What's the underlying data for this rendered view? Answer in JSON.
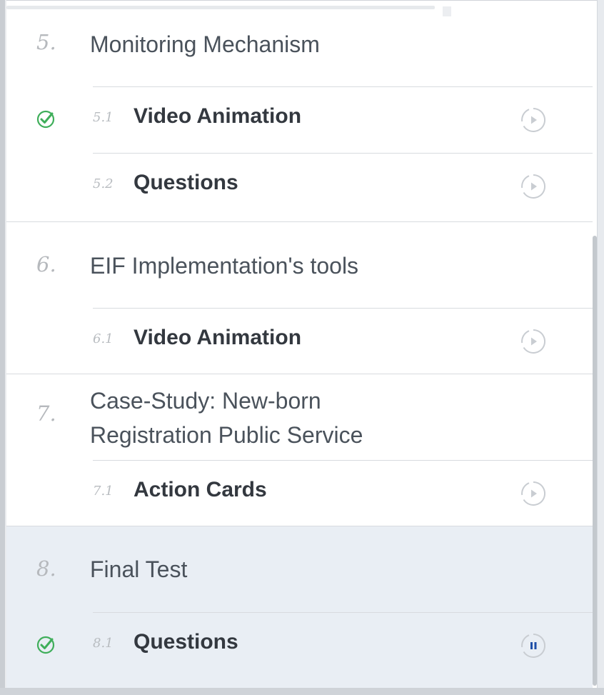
{
  "sections": [
    {
      "number": "5.",
      "title": "Monitoring Mechanism",
      "lessons": [
        {
          "number": "5.1",
          "title": "Video Animation",
          "completed": true,
          "state_icon": "play-circle-icon"
        },
        {
          "number": "5.2",
          "title": "Questions",
          "completed": false,
          "state_icon": "play-circle-icon"
        }
      ]
    },
    {
      "number": "6.",
      "title": "EIF Implementation's tools",
      "lessons": [
        {
          "number": "6.1",
          "title": "Video Animation",
          "completed": false,
          "state_icon": "play-circle-icon"
        }
      ]
    },
    {
      "number": "7.",
      "title_line1": "Case-Study: New-born",
      "title_line2": "Registration Public Service",
      "lessons": [
        {
          "number": "7.1",
          "title": "Action Cards",
          "completed": false,
          "state_icon": "play-circle-icon"
        }
      ]
    },
    {
      "number": "8.",
      "title": "Final Test",
      "active": true,
      "lessons": [
        {
          "number": "8.1",
          "title": "Questions",
          "completed": true,
          "state_icon": "pause-circle-icon"
        }
      ]
    }
  ],
  "colors": {
    "active_bg": "#e9eef4",
    "check": "#3fae5a",
    "pause": "#1f4fa8",
    "play": "#c9cdd2"
  }
}
